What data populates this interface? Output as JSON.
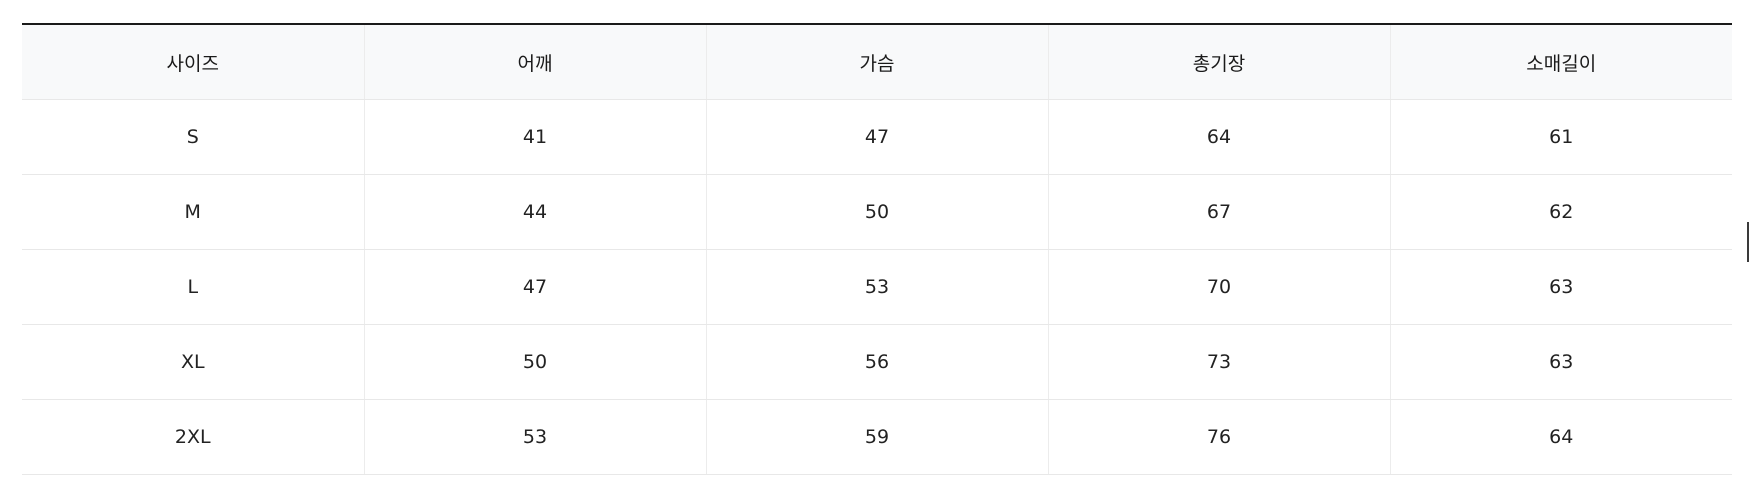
{
  "size_table": {
    "headers": [
      "사이즈",
      "어깨",
      "가슴",
      "총기장",
      "소매길이"
    ],
    "rows": [
      [
        "S",
        "41",
        "47",
        "64",
        "61"
      ],
      [
        "M",
        "44",
        "50",
        "67",
        "62"
      ],
      [
        "L",
        "47",
        "53",
        "70",
        "63"
      ],
      [
        "XL",
        "50",
        "56",
        "73",
        "63"
      ],
      [
        "2XL",
        "53",
        "59",
        "76",
        "64"
      ]
    ]
  },
  "colors": {
    "header_background": "#f8f9fa",
    "top_border": "#1a1a1a",
    "grid_line": "#e8e8e8"
  }
}
